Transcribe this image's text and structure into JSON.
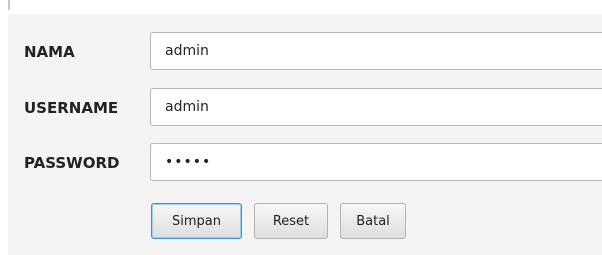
{
  "form": {
    "fields": [
      {
        "label": "NAMA",
        "value": "admin"
      },
      {
        "label": "USERNAME",
        "value": "admin"
      },
      {
        "label": "PASSWORD",
        "value": "admin"
      }
    ],
    "buttons": {
      "simpan": "Simpan",
      "reset": "Reset",
      "batal": "Batal"
    }
  },
  "colors": {
    "panel_background": "#f4f4f4",
    "focused_button_border": "#3a93d6"
  }
}
